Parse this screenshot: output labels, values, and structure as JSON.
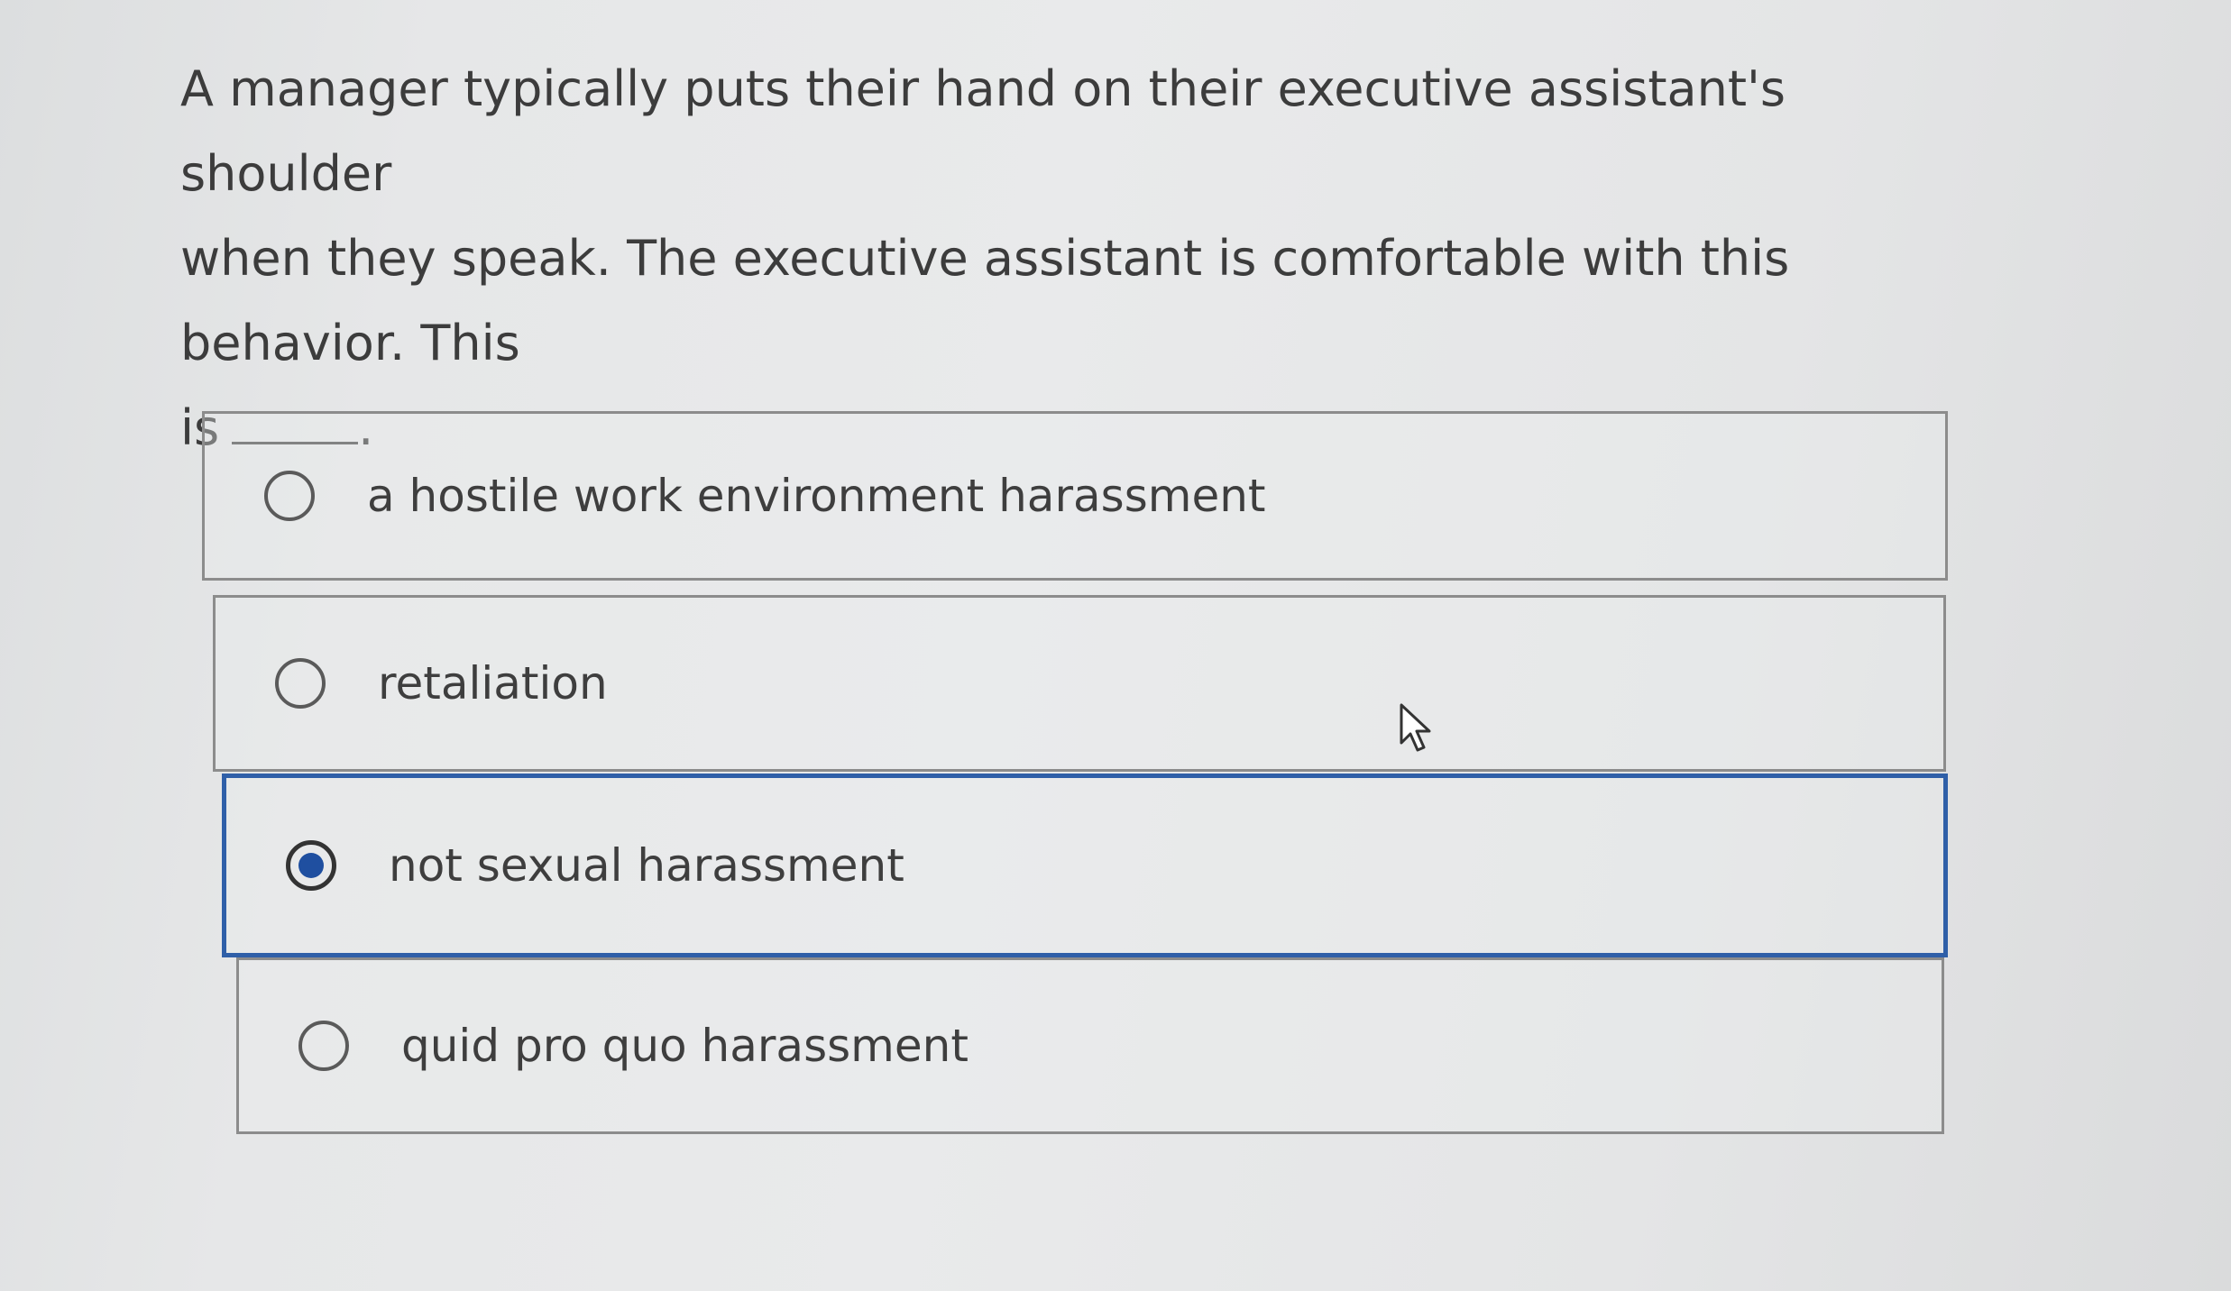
{
  "question": {
    "text_line1": "A manager typically puts their hand on their executive assistant's shoulder",
    "text_line2": "when they speak. The executive assistant is comfortable with this behavior. This",
    "text_line3_prefix": "is",
    "text_line3_suffix": "."
  },
  "options": [
    {
      "label": "a hostile work environment harassment",
      "selected": false
    },
    {
      "label": "retaliation",
      "selected": false
    },
    {
      "label": "not sexual harassment",
      "selected": true
    },
    {
      "label": "quid pro quo harassment",
      "selected": false
    }
  ],
  "colors": {
    "selected_border": "#2f5fa8",
    "radio_fill": "#1f4fa0"
  },
  "icons": {
    "cursor": "mouse-pointer-icon"
  }
}
